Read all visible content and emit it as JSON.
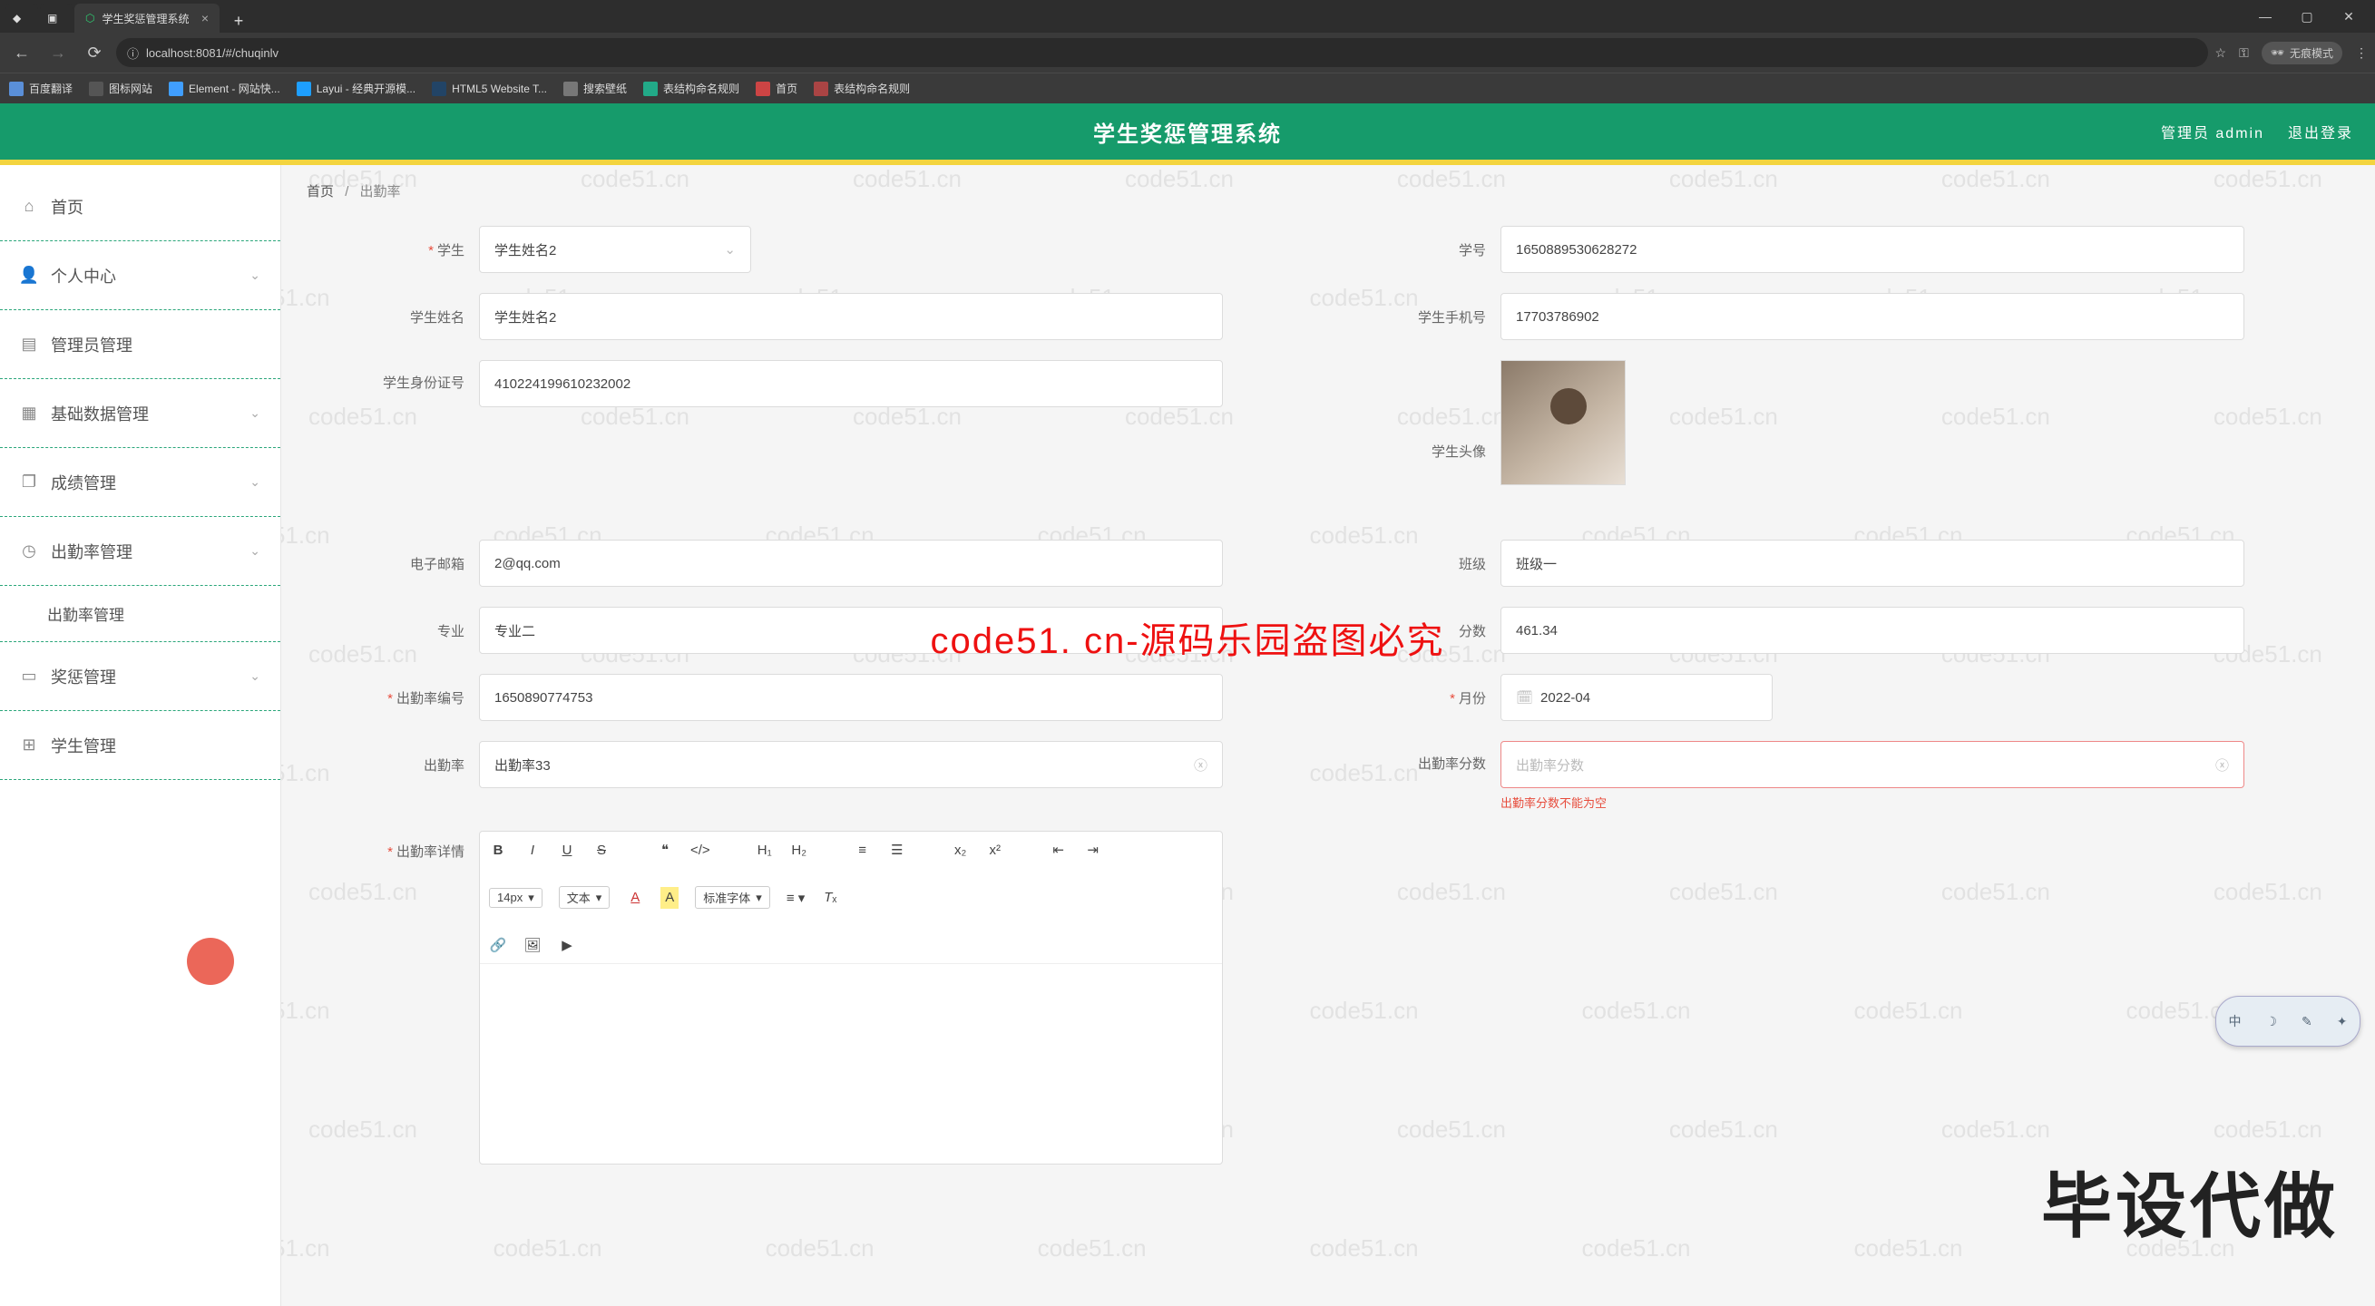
{
  "browser": {
    "tab_title": "学生奖惩管理系统",
    "url": "localhost:8081/#/chuqinlv",
    "anon_mode": "无痕模式",
    "window_controls": {
      "min": "—",
      "max": "▢",
      "close": "✕"
    },
    "bookmarks": [
      {
        "label": "百度翻译"
      },
      {
        "label": "图标网站"
      },
      {
        "label": "Element - 网站快..."
      },
      {
        "label": "Layui - 经典开源模..."
      },
      {
        "label": "HTML5 Website T..."
      },
      {
        "label": "搜索壁纸"
      },
      {
        "label": "表结构命名规则"
      },
      {
        "label": "首页"
      },
      {
        "label": "表结构命名规则"
      }
    ]
  },
  "header": {
    "title": "学生奖惩管理系统",
    "admin_label": "管理员 admin",
    "logout_label": "退出登录"
  },
  "sidebar": {
    "items": [
      {
        "icon": "home",
        "label": "首页"
      },
      {
        "icon": "user",
        "label": "个人中心",
        "chev": true
      },
      {
        "icon": "admin",
        "label": "管理员管理"
      },
      {
        "icon": "data",
        "label": "基础数据管理",
        "chev": true
      },
      {
        "icon": "copy",
        "label": "成绩管理",
        "chev": true
      },
      {
        "icon": "clock",
        "label": "出勤率管理",
        "chev": true
      },
      {
        "icon": "",
        "label": "出勤率管理",
        "sub": true
      },
      {
        "icon": "book",
        "label": "奖惩管理",
        "chev": true
      },
      {
        "icon": "grid",
        "label": "学生管理"
      }
    ]
  },
  "crumb": {
    "home": "首页",
    "current": "出勤率"
  },
  "form": {
    "student_label": "学生",
    "student_value": "学生姓名2",
    "student_id_label": "学号",
    "student_id_value": "1650889530628272",
    "student_name_label": "学生姓名",
    "student_name_value": "学生姓名2",
    "phone_label": "学生手机号",
    "phone_value": "17703786902",
    "idcard_label": "学生身份证号",
    "idcard_value": "410224199610232002",
    "avatar_label": "学生头像",
    "email_label": "电子邮箱",
    "email_value": "2@qq.com",
    "class_label": "班级",
    "class_value": "班级一",
    "major_label": "专业",
    "major_value": "专业二",
    "score_label": "分数",
    "score_value": "461.34",
    "attn_no_label": "出勤率编号",
    "attn_no_value": "1650890774753",
    "month_label": "月份",
    "month_value": "2022-04",
    "attn_rate_label": "出勤率",
    "attn_rate_value": "出勤率33",
    "attn_score_label": "出勤率分数",
    "attn_score_placeholder": "出勤率分数",
    "attn_score_error": "出勤率分数不能为空",
    "attn_detail_label": "出勤率详情",
    "editor": {
      "font_size": "14px",
      "text_type": "文本",
      "std_font": "标准字体"
    }
  },
  "overlays": {
    "red_text": "code51. cn-源码乐园盗图必究",
    "big_text": "毕设代做",
    "ime_badge": "中"
  },
  "watermark_text": "code51.cn"
}
